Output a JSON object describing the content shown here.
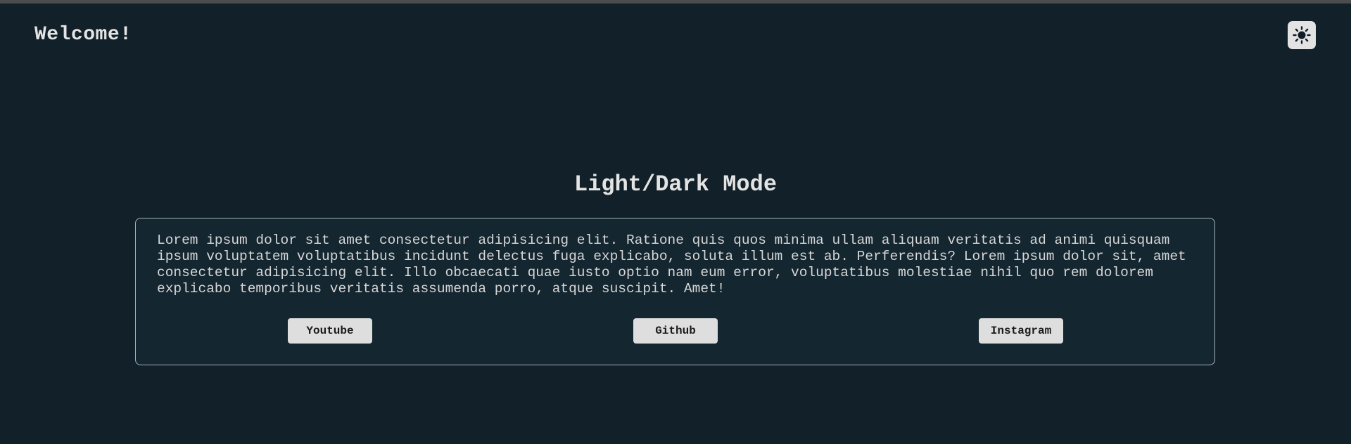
{
  "header": {
    "greeting": "Welcome!",
    "theme_toggle_icon": "sun-icon"
  },
  "main": {
    "title": "Light/Dark Mode",
    "card": {
      "text": "Lorem ipsum dolor sit amet consectetur adipisicing elit. Ratione quis quos minima ullam aliquam veritatis ad animi quisquam ipsum voluptatem voluptatibus incidunt delectus fuga explicabo, soluta illum est ab. Perferendis? Lorem ipsum dolor sit, amet consectetur adipisicing elit. Illo obcaecati quae iusto optio nam eum error, voluptatibus molestiae nihil quo rem dolorem explicabo temporibus veritatis assumenda porro, atque suscipit. Amet!",
      "buttons": [
        {
          "label": "Youtube"
        },
        {
          "label": "Github"
        },
        {
          "label": "Instagram"
        }
      ]
    }
  },
  "colors": {
    "background": "#112029",
    "card_background": "#142630",
    "card_border": "#a9b3b8",
    "text": "#e4e4e4",
    "button_background": "#dedede"
  }
}
